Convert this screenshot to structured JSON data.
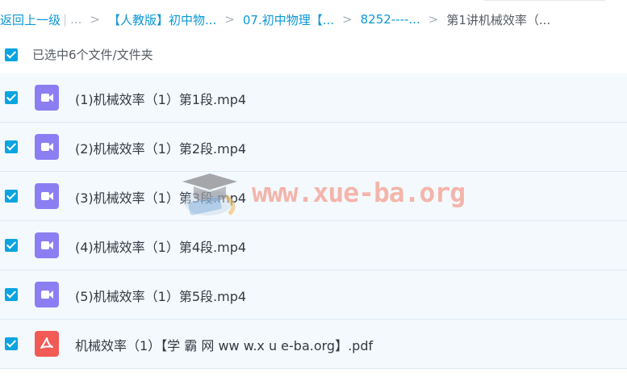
{
  "breadcrumb": {
    "back_label": "返回上一级",
    "ellipsis": "...",
    "items": [
      "【人教版】初中物...",
      "07.初中物理【...",
      "8252----...",
      "第1讲机械效率（..."
    ],
    "separator": ">"
  },
  "selection": {
    "text": "已选中6个文件/文件夹"
  },
  "files": [
    {
      "name": "(1)机械效率（1）第1段.mp4",
      "type": "video"
    },
    {
      "name": "(2)机械效率（1）第2段.mp4",
      "type": "video"
    },
    {
      "name": "(3)机械效率（1）第3段.mp4",
      "type": "video"
    },
    {
      "name": "(4)机械效率（1）第4段.mp4",
      "type": "video"
    },
    {
      "name": "(5)机械效率（1）第5段.mp4",
      "type": "video"
    },
    {
      "name": "机械效率（1）【学 霸 网 ww w.x u e-ba.org】.pdf",
      "type": "pdf"
    }
  ],
  "watermark": {
    "text": "www.xue-ba.org"
  },
  "colors": {
    "link": "#0a98d6",
    "checkbox": "#0aa4e0",
    "video_icon": "#8c7ef2",
    "pdf_icon": "#f25a55",
    "row_bg": "#f4f9fd"
  }
}
